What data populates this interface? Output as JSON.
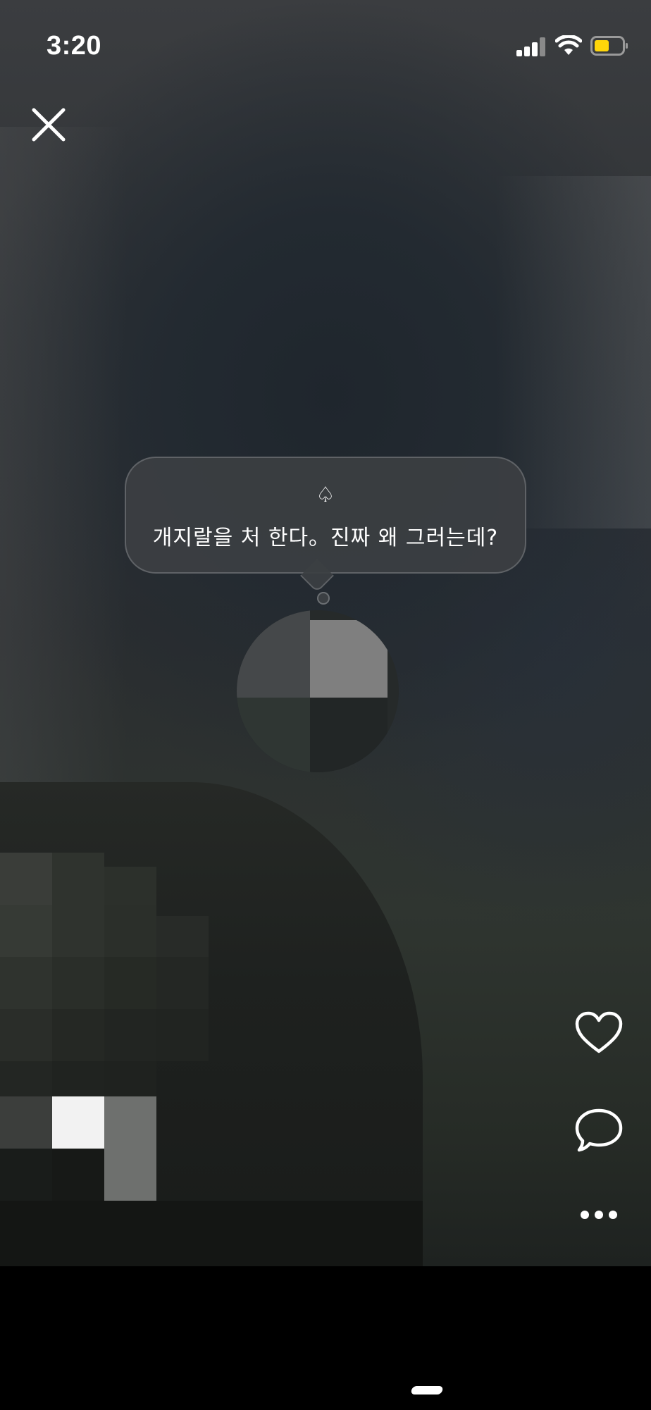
{
  "status_bar": {
    "time": "3:20",
    "battery_color": "#FFD60A"
  },
  "toolbar": {
    "close_icon": "close-icon"
  },
  "post": {
    "spade_symbol": "♤",
    "caption": "개지랄을 처 한다。진짜 왜 그러는데?"
  },
  "actions": {
    "like_icon": "heart-outline-icon",
    "comment_icon": "speech-bubble-icon",
    "more_icon": "more-dots-icon"
  }
}
